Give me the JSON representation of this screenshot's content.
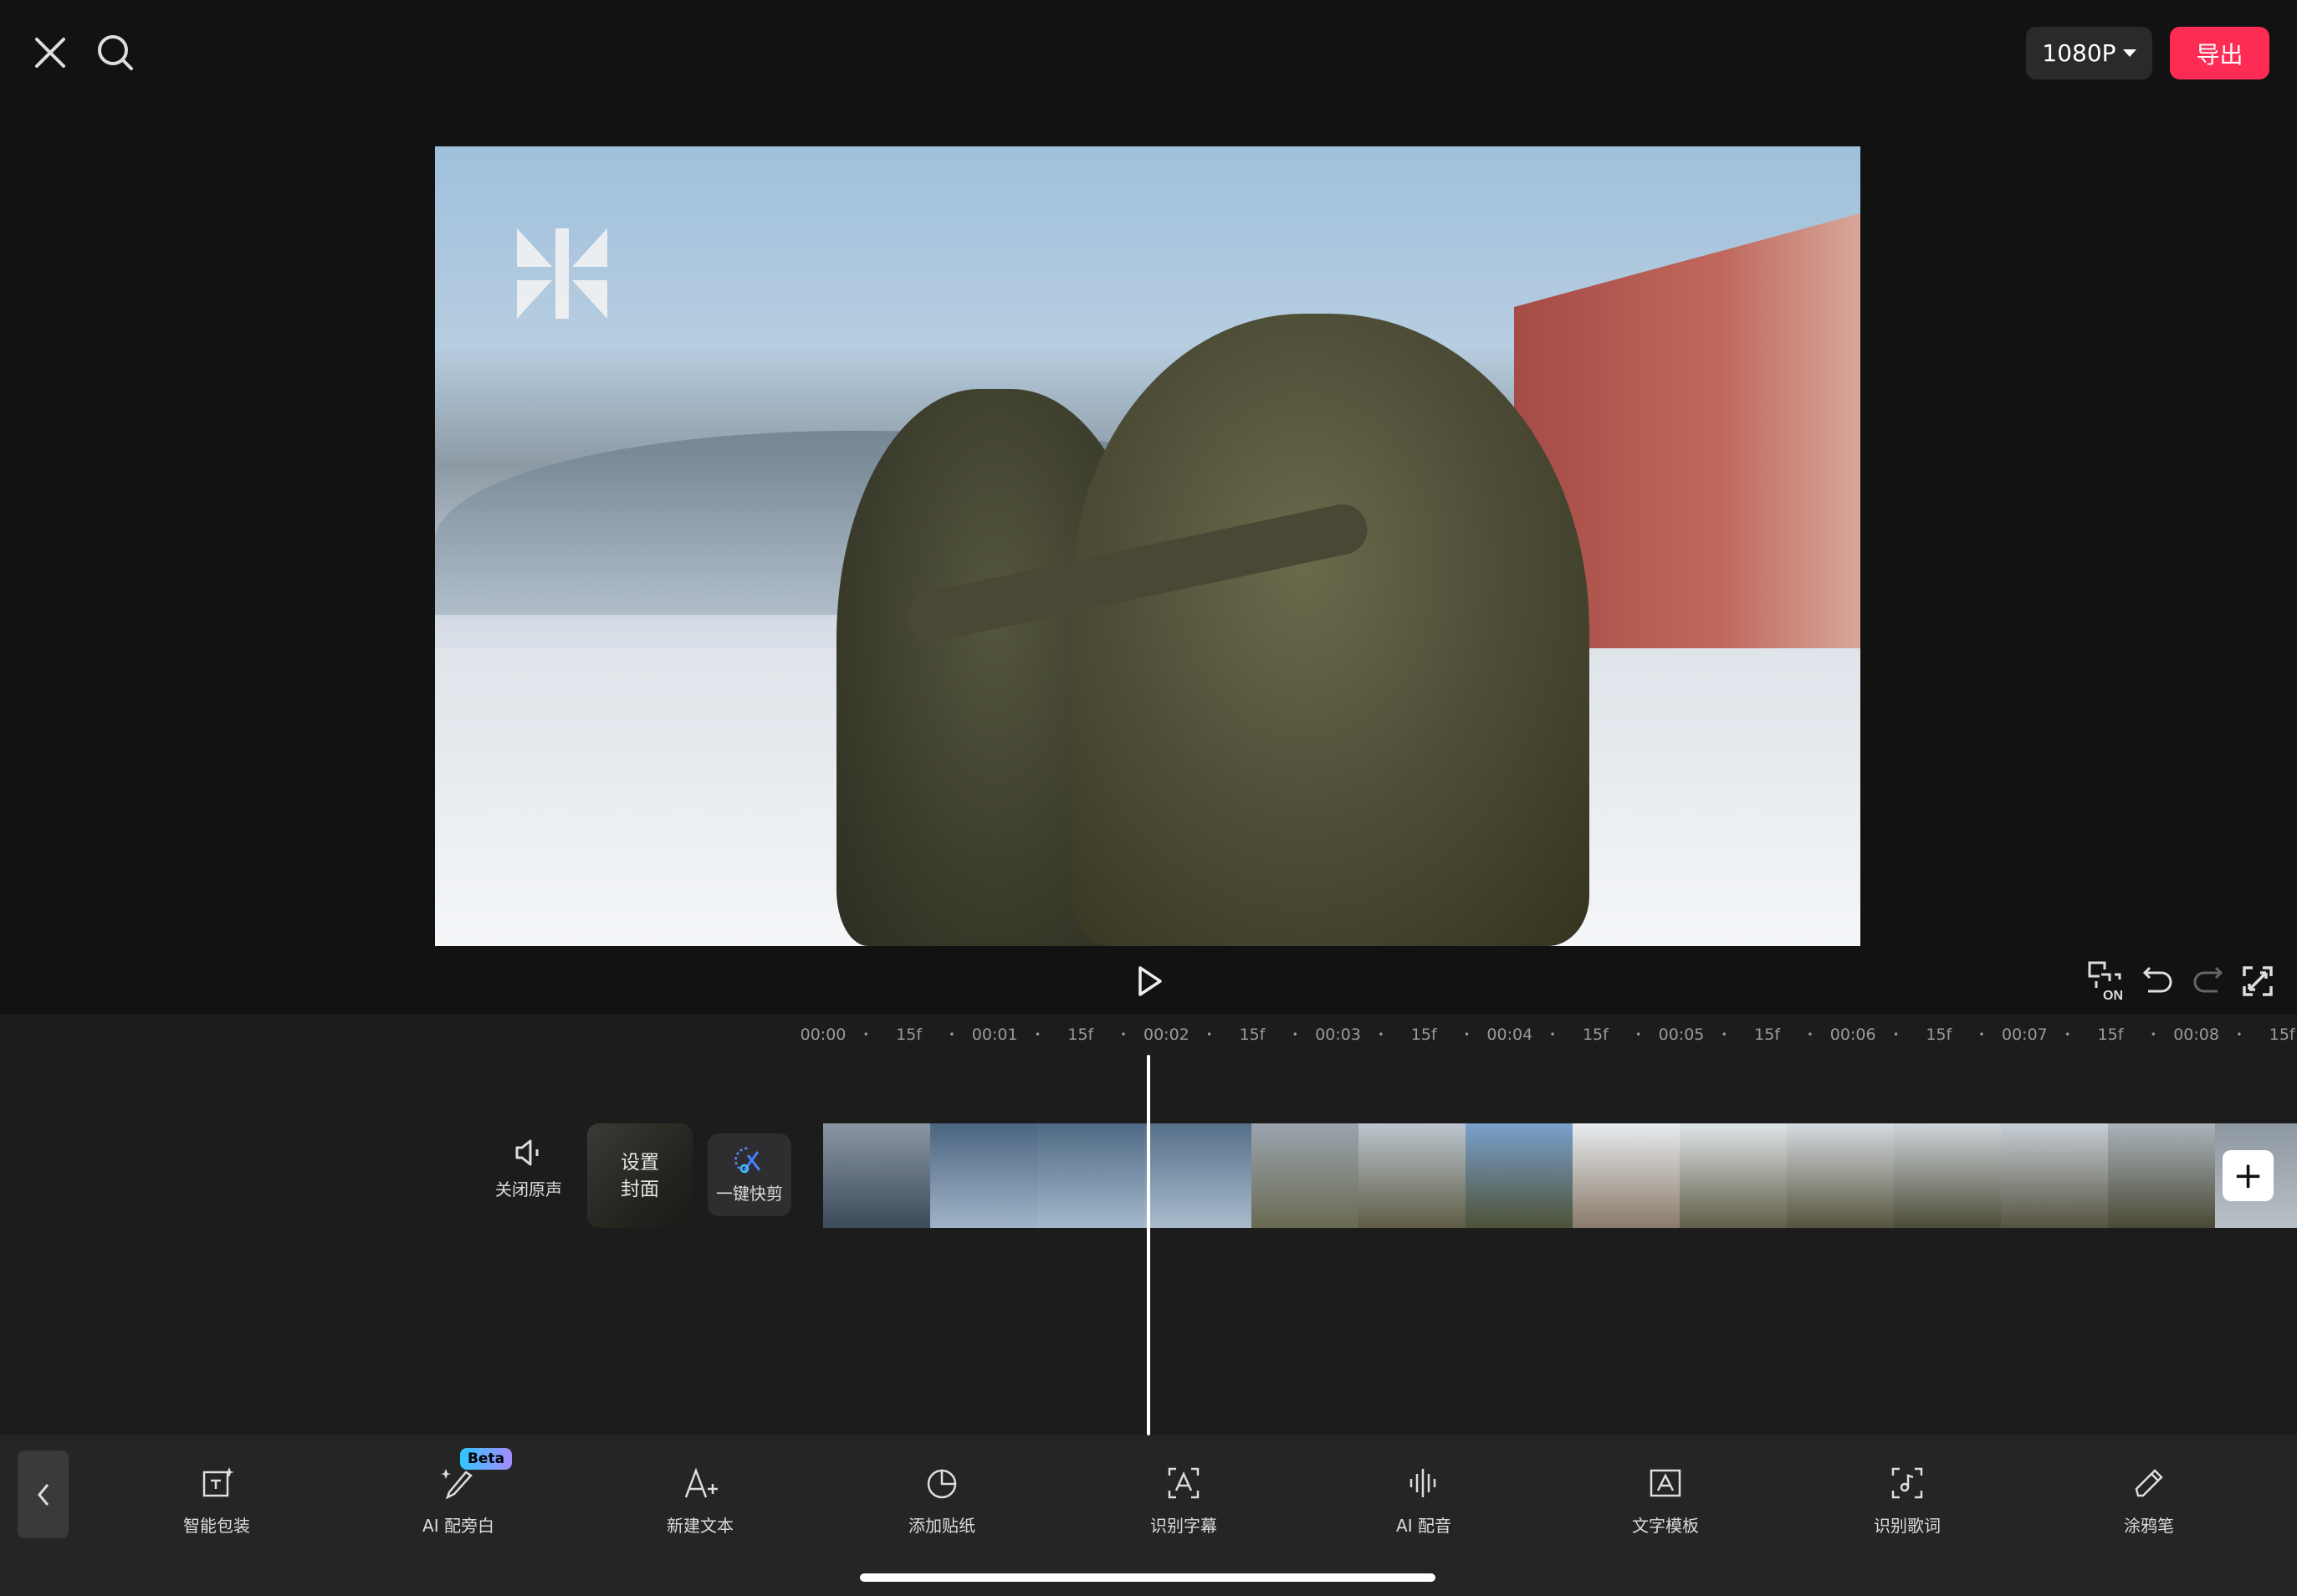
{
  "topbar": {
    "close_icon": "close-icon",
    "search_icon": "search-icon",
    "resolution": "1080P",
    "export_label": "导出",
    "export_color": "#fe2c55"
  },
  "controls": {
    "play_icon": "play-icon",
    "right_icons": [
      "fullscreen-preview-on-icon",
      "undo-icon",
      "redo-icon",
      "fullscreen-icon"
    ],
    "pip_badge": "ON"
  },
  "ruler": [
    "00:00",
    "15f",
    "00:01",
    "15f",
    "00:02",
    "15f",
    "00:03",
    "15f",
    "00:04",
    "15f",
    "00:05",
    "15f",
    "00:06",
    "15f",
    "00:07",
    "15f",
    "00:08",
    "15f"
  ],
  "track": {
    "mute_label": "关闭原声",
    "cover_label_1": "设置",
    "cover_label_2": "封面",
    "quick_label": "一键快剪",
    "add_label": "+"
  },
  "toolbar": {
    "beta": "Beta",
    "items": [
      {
        "label": "智能包装",
        "icon": "smart-package-icon"
      },
      {
        "label": "AI 配旁白",
        "icon": "ai-narration-icon"
      },
      {
        "label": "新建文本",
        "icon": "new-text-icon"
      },
      {
        "label": "添加贴纸",
        "icon": "sticker-icon"
      },
      {
        "label": "识别字幕",
        "icon": "auto-caption-icon"
      },
      {
        "label": "AI 配音",
        "icon": "ai-voice-icon"
      },
      {
        "label": "文字模板",
        "icon": "text-template-icon"
      },
      {
        "label": "识别歌词",
        "icon": "lyrics-icon"
      },
      {
        "label": "涂鸦笔",
        "icon": "doodle-pen-icon"
      }
    ]
  }
}
